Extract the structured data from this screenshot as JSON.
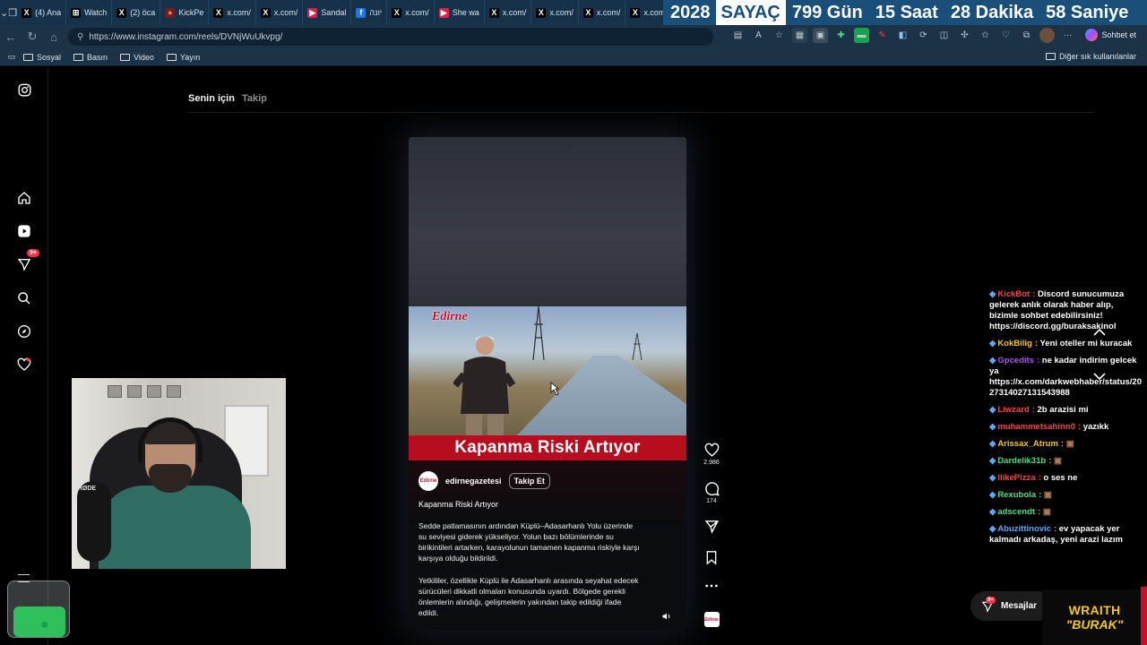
{
  "browser": {
    "tabs": [
      {
        "label": "(4) Ana",
        "icon": "x-logo-icon"
      },
      {
        "label": "Watch",
        "icon": "frame-icon"
      },
      {
        "label": "(2) öca",
        "icon": "x-logo-icon"
      },
      {
        "label": "KickPe",
        "icon": "kick-icon"
      },
      {
        "label": "x.com/",
        "icon": "x-logo-icon"
      },
      {
        "label": "x.com/",
        "icon": "x-logo-icon"
      },
      {
        "label": "Sandal",
        "icon": "youtube-icon"
      },
      {
        "label": "יונה",
        "icon": "facebook-icon"
      },
      {
        "label": "x.com/",
        "icon": "x-logo-icon"
      },
      {
        "label": "She wa",
        "icon": "youtube-icon"
      },
      {
        "label": "x.com/",
        "icon": "x-logo-icon"
      },
      {
        "label": "x.com/",
        "icon": "x-logo-icon"
      },
      {
        "label": "x.com/",
        "icon": "x-logo-icon"
      },
      {
        "label": "x.com/",
        "icon": "x-logo-icon"
      }
    ],
    "url": "https://www.instagram.com/reels/DVNjWuUkvpg/",
    "copilot_label": "Sohbet et",
    "bookmarks": [
      "Sosyal",
      "Basın",
      "Video",
      "Yayın"
    ],
    "other_bookmarks": "Diğer sık kullanılanlar"
  },
  "counter": {
    "year": "2028",
    "label": "SAYAÇ",
    "days": "799 Gün",
    "hours": "15 Saat",
    "minutes": "28 Dakika",
    "seconds": "58 Saniye"
  },
  "instagram": {
    "nav_badge": "9+",
    "feed_tabs": {
      "for_you": "Senin için",
      "following": "Takip"
    },
    "reel": {
      "brand": "Edirne",
      "caption_band": "Kapanma Riski Artıyor",
      "author": "edirnegazetesi",
      "avatar_text": "Edirne",
      "follow_label": "Takip Et",
      "title": "Kapanma Riski Artıyor",
      "paragraph1": "Sedde patlamasının ardından Küplü–Adasarhanlı Yolu üzerinde su seviyesi giderek yükseliyor. Yolun bazı bölümlerinde su birikintileri artarken, karayolunun tamamen kapanma riskiyle karşı karşıya olduğu bildirildi.",
      "paragraph2": "Yetkililer, özellikle Küplü ile Adasarhanlı arasında seyahat edecek sürücüleri dikkatli olmaları konusunda uyardı. Bölgede gerekli önlemlerin alındığı, gelişmelerin yakından takip edildiği ifade edildi.",
      "likes": "2.986",
      "comments": "174"
    },
    "messages_label": "Mesajlar",
    "messages_badge": "9+"
  },
  "webcam": {
    "mic_label": "RØDE"
  },
  "chat": [
    {
      "user": "KickBot",
      "text": "Discord sunucumuza gelerek anlık olarak haber alıp, bizimle sohbet edebilirsiniz! https://discord.gg/buraksakinol",
      "color": "#ef4444"
    },
    {
      "user": "KokBilig",
      "text": "Yeni oteller mi kuracak",
      "color": "#f5c518"
    },
    {
      "user": "Gpcedits",
      "text": "ne kadar indirim gelcek ya https://x.com/darkwebhaber/status/2027314027131543988",
      "color": "#a855f7"
    },
    {
      "user": "Liwzard",
      "text": "2b arazisi mi",
      "color": "#ef4444"
    },
    {
      "user": "muhammetsahinn0",
      "text": "yazıkk",
      "color": "#ef4444"
    },
    {
      "user": "Arissax_Atrum",
      "text": "",
      "color": "#f5c518"
    },
    {
      "user": "Dardelik31b",
      "text": "",
      "color": "#4ade80"
    },
    {
      "user": "llikePizza",
      "text": "o ses ne",
      "color": "#ef4444"
    },
    {
      "user": "Rexubola",
      "text": "",
      "color": "#4ade80"
    },
    {
      "user": "adscendt",
      "text": "",
      "color": "#4ade80"
    },
    {
      "user": "Abuzittinovic",
      "text": "ev yapacak yer kalmadı arkadaş, yeni arazi lazım",
      "color": "#60a5fa"
    }
  ],
  "stream_logo": {
    "line1": "WRAITH",
    "line2": "\"BURAK\""
  }
}
